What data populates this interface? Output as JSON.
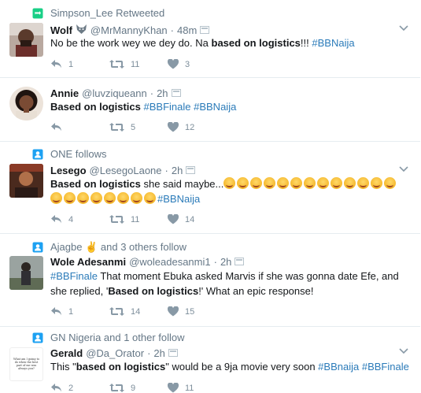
{
  "tweets": [
    {
      "context": "Simpson_Lee Retweeted",
      "name": "Wolf",
      "name_emoji": "wolf",
      "handle": "@MrMannyKhan",
      "dot": "·",
      "time": "48m",
      "text_parts": [
        "No be the work wey we dey do. Na ",
        "based on logistics",
        "!!! ",
        "#BBNaija"
      ],
      "replies": "1",
      "retweets": "11",
      "likes": "3"
    },
    {
      "context": "",
      "name": "Annie",
      "handle": "@luvziqueann",
      "dot": "·",
      "time": "2h",
      "text_parts": [
        "Based on logistics",
        " ",
        "#BBFinale",
        " ",
        "#BBNaija"
      ],
      "replies": "",
      "retweets": "5",
      "likes": "12"
    },
    {
      "context": "ONE follows",
      "name": "Lesego",
      "handle": "@LesegoLaone",
      "dot": "·",
      "time": "2h",
      "text_parts": [
        "Based on logistics",
        " she said maybe...",
        "#BBNaija"
      ],
      "emoji_count_line1": 13,
      "emoji_count_line2": 8,
      "replies": "4",
      "retweets": "11",
      "likes": "14"
    },
    {
      "context": "Ajagbe ✌ and 3 others follow",
      "name": "Wole Adesanmi",
      "handle": "@woleadesanmi1",
      "dot": "·",
      "time": "2h",
      "text_parts": [
        "#BBFinale",
        " That moment Ebuka asked Marvis if she was gonna date Efe, and she replied, '",
        "Based on logistics",
        "!' What an epic response!"
      ],
      "replies": "1",
      "retweets": "14",
      "likes": "15"
    },
    {
      "context": "GN Nigeria and 1 other follow",
      "name": "Gerald",
      "handle": "@Da_Orator",
      "dot": "·",
      "time": "2h",
      "text_parts": [
        "This \"",
        "based on logistics",
        "\" would be a 9ja movie very soon ",
        "#BBnaija",
        " ",
        "#BBFinale"
      ],
      "avatar_text": "What am I going to do when the best part of me was always you?",
      "replies": "2",
      "retweets": "9",
      "likes": "11"
    }
  ],
  "colors": {
    "hashtag": "#2b7bb9",
    "meta": "#657786",
    "retweet_green": "#19cf86",
    "follow_blue": "#1da1f2"
  }
}
